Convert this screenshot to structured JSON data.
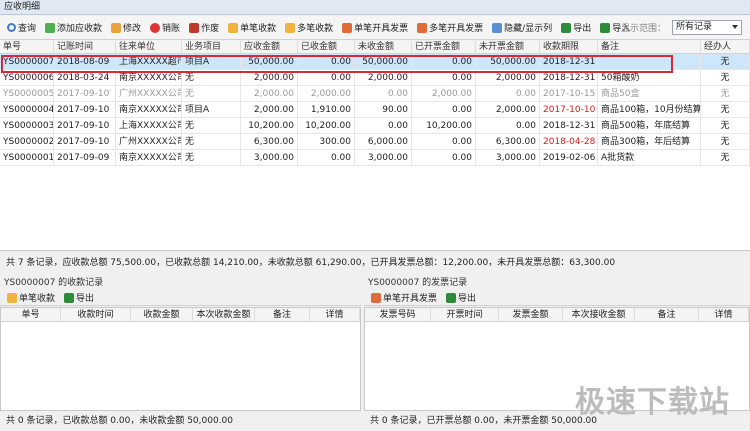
{
  "window": {
    "title": "应收明细"
  },
  "toolbar": {
    "query": "查询",
    "add": "添加应收款",
    "edit": "修改",
    "delete": "销账",
    "void": "作废",
    "single_receipt": "单笔收款",
    "multi_receipt": "多笔收款",
    "single_invoice": "单笔开具发票",
    "multi_invoice": "多笔开具发票",
    "toggle_columns": "隐藏/显示列",
    "export": "导出",
    "import": "导入"
  },
  "range": {
    "label": "显示范围：",
    "value": "所有记录"
  },
  "columns": [
    "单号",
    "记账时间",
    "往来单位",
    "业务项目",
    "应收金额",
    "已收金额",
    "未收金额",
    "已开票金额",
    "未开票金额",
    "收款期限",
    "备注",
    "经办人"
  ],
  "rows": [
    {
      "no": "YS0000007",
      "date": "2018-08-09",
      "unit": "上海XXXXX超市",
      "project": "项目A",
      "due": "50,000.00",
      "received": "0.00",
      "unreceived": "50,000.00",
      "invoiced": "0.00",
      "uninvoiced": "50,000.00",
      "deadline": "2018-12-31",
      "note": "",
      "handler": "无"
    },
    {
      "no": "YS0000006",
      "date": "2018-03-24",
      "unit": "南京XXXXX公司",
      "project": "无",
      "due": "2,000.00",
      "received": "0.00",
      "unreceived": "2,000.00",
      "invoiced": "0.00",
      "uninvoiced": "2,000.00",
      "deadline": "2018-12-31",
      "note": "50箱酸奶",
      "handler": "无"
    },
    {
      "no": "YS0000005",
      "date": "2017-09-10",
      "unit": "广州XXXXX公司",
      "project": "无",
      "due": "2,000.00",
      "received": "2,000.00",
      "unreceived": "0.00",
      "invoiced": "2,000.00",
      "uninvoiced": "0.00",
      "deadline": "2017-10-15",
      "note": "商品50盒",
      "handler": "无"
    },
    {
      "no": "YS0000004",
      "date": "2017-09-10",
      "unit": "南京XXXXX公司",
      "project": "项目A",
      "due": "2,000.00",
      "received": "1,910.00",
      "unreceived": "90.00",
      "invoiced": "0.00",
      "uninvoiced": "2,000.00",
      "deadline": "2017-10-10",
      "note": "商品100箱，10月份结算",
      "handler": "无"
    },
    {
      "no": "YS0000003",
      "date": "2017-09-10",
      "unit": "上海XXXXX公司",
      "project": "无",
      "due": "10,200.00",
      "received": "10,200.00",
      "unreceived": "0.00",
      "invoiced": "10,200.00",
      "uninvoiced": "0.00",
      "deadline": "2018-12-31",
      "note": "商品500箱，年底结算",
      "handler": "无"
    },
    {
      "no": "YS0000002",
      "date": "2017-09-10",
      "unit": "广州XXXXX公司",
      "project": "无",
      "due": "6,300.00",
      "received": "300.00",
      "unreceived": "6,000.00",
      "invoiced": "0.00",
      "uninvoiced": "6,300.00",
      "deadline": "2018-04-28",
      "note": "商品300箱，年后结算",
      "handler": "无"
    },
    {
      "no": "YS0000001",
      "date": "2017-09-09",
      "unit": "南京XXXXX公司",
      "project": "无",
      "due": "3,000.00",
      "received": "0.00",
      "unreceived": "3,000.00",
      "invoiced": "0.00",
      "uninvoiced": "3,000.00",
      "deadline": "2019-02-06",
      "note": "A批货款",
      "handler": "无"
    }
  ],
  "summary": "共 7 条记录，应收款总额 75,500.00，已收款总额 14,210.00，未收款总额 61,290.00，已开具发票总额：12,200.00，未开具发票总额：63,300.00",
  "receipts": {
    "title": "YS0000007 的收款记录",
    "btn_single": "单笔收款",
    "btn_export": "导出",
    "columns": [
      "单号",
      "收款时间",
      "收款金额",
      "本次收款金额",
      "备注",
      "详情"
    ],
    "footer": "共 0 条记录，已收款总额 0.00，未收款金额 50,000.00"
  },
  "invoices": {
    "title": "YS0000007 的发票记录",
    "btn_single": "单笔开具发票",
    "btn_export": "导出",
    "columns": [
      "发票号码",
      "开票时间",
      "发票金额",
      "本次接收金额",
      "备注",
      "详情"
    ],
    "footer": "共 0 条记录，已开票总额 0.00，未开票金额 50,000.00"
  },
  "watermark": "极速下载站",
  "colors": {
    "selection": "#cde6fa",
    "highlight_border": "#d42b3a",
    "overdue": "#d02020"
  }
}
